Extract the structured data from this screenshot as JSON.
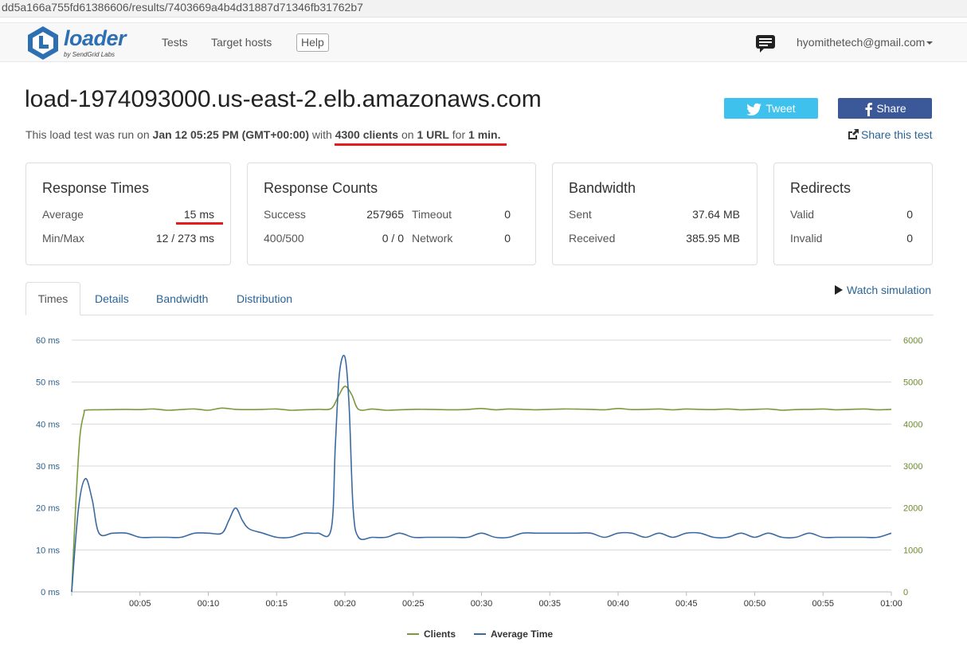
{
  "browser": {
    "url": "dd5a166a755fd61386606/results/7403669a4b4d31887d71346fb31762b7"
  },
  "navbar": {
    "logo_text": "loader",
    "logo_sub": "by SendGrid Labs",
    "links": [
      "Tests",
      "Target hosts"
    ],
    "help_label": "Help",
    "user": "hyomithetech@gmail.com",
    "icons": [
      "loader-logo-icon",
      "chat-icon",
      "chevron-down-icon"
    ]
  },
  "header": {
    "title": "load-1974093000.us-east-2.elb.amazonaws.com",
    "summary": {
      "prefix": "This load test was run on",
      "date": "Jan 12 05:25 PM (GMT+00:00)",
      "with": "with",
      "clients": "4300 clients",
      "on": "on",
      "urls": "1 URL",
      "for": "for",
      "duration": "1 min."
    },
    "tweet_label": "Tweet",
    "share_label": "Share",
    "share_test_label": "Share this test"
  },
  "panels": {
    "response_times": {
      "title": "Response Times",
      "average_label": "Average",
      "average_value": "15 ms",
      "minmax_label": "Min/Max",
      "minmax_value": "12 / 273 ms"
    },
    "response_counts": {
      "title": "Response Counts",
      "success_label": "Success",
      "success_value": "257965",
      "timeout_label": "Timeout",
      "timeout_value": "0",
      "err_label": "400/500",
      "err_value": "0 / 0",
      "network_label": "Network",
      "network_value": "0"
    },
    "bandwidth": {
      "title": "Bandwidth",
      "sent_label": "Sent",
      "sent_value": "37.64 MB",
      "received_label": "Received",
      "received_value": "385.95 MB"
    },
    "redirects": {
      "title": "Redirects",
      "valid_label": "Valid",
      "valid_value": "0",
      "invalid_label": "Invalid",
      "invalid_value": "0"
    }
  },
  "tabs": [
    "Times",
    "Details",
    "Bandwidth",
    "Distribution"
  ],
  "watch_simulation": "Watch simulation",
  "colors": {
    "clients": "#7a9b3a",
    "average_time": "#3a6aa0",
    "link": "#2a6496",
    "tweet": "#3ec1ec",
    "facebook": "#3b5998",
    "highlight": "#e31c1c"
  },
  "chart_data": {
    "type": "line",
    "x_ticks": [
      "00:05",
      "00:10",
      "00:15",
      "00:20",
      "00:25",
      "00:30",
      "00:35",
      "00:40",
      "00:45",
      "00:50",
      "00:55",
      "01:00"
    ],
    "y_left_ticks": [
      "60 ms",
      "50 ms",
      "40 ms",
      "30 ms",
      "20 ms",
      "10 ms",
      "0 ms"
    ],
    "y_right_ticks": [
      "6000",
      "5000",
      "4000",
      "3000",
      "2000",
      "1000",
      "0"
    ],
    "ylim_left": [
      0,
      60
    ],
    "ylim_right": [
      0,
      6000
    ],
    "xlim": [
      0,
      60
    ],
    "grid": true,
    "legend_position": "bottom-center",
    "series": [
      {
        "name": "Clients",
        "axis": "right",
        "color": "#7a9b3a",
        "x": [
          0,
          0.3,
          0.6,
          0.9,
          1,
          2,
          3,
          4,
          5,
          6,
          7,
          8,
          9,
          10,
          11,
          12,
          13,
          14,
          15,
          16,
          17,
          18,
          19,
          19.5,
          20,
          20.5,
          21,
          22,
          23,
          24,
          25,
          26,
          27,
          28,
          29,
          30,
          31,
          32,
          33,
          34,
          35,
          36,
          37,
          38,
          39,
          40,
          41,
          42,
          43,
          44,
          45,
          46,
          47,
          48,
          49,
          50,
          51,
          52,
          53,
          54,
          55,
          56,
          57,
          58,
          59,
          60
        ],
        "y": [
          0,
          2100,
          3700,
          4250,
          4330,
          4340,
          4345,
          4350,
          4345,
          4360,
          4330,
          4345,
          4360,
          4330,
          4380,
          4350,
          4345,
          4350,
          4360,
          4330,
          4340,
          4350,
          4370,
          4650,
          4900,
          4700,
          4350,
          4360,
          4330,
          4340,
          4350,
          4350,
          4345,
          4340,
          4350,
          4370,
          4340,
          4360,
          4350,
          4340,
          4350,
          4360,
          4355,
          4350,
          4340,
          4370,
          4345,
          4350,
          4360,
          4340,
          4360,
          4350,
          4345,
          4360,
          4340,
          4350,
          4360,
          4330,
          4345,
          4350,
          4360,
          4340,
          4350,
          4360,
          4340,
          4350
        ]
      },
      {
        "name": "Average Time",
        "axis": "left",
        "color": "#3a6aa0",
        "x": [
          0,
          0.5,
          1,
          1.5,
          2,
          3,
          4,
          5,
          6,
          7,
          8,
          9,
          10,
          11,
          11.5,
          12,
          12.5,
          13,
          14,
          15,
          16,
          17,
          18,
          19,
          19.3,
          19.6,
          20,
          20.3,
          20.6,
          21,
          22,
          23,
          24,
          25,
          26,
          27,
          28,
          29,
          30,
          31,
          32,
          33,
          34,
          35,
          36,
          37,
          38,
          39,
          40,
          41,
          42,
          43,
          44,
          45,
          46,
          47,
          48,
          49,
          50,
          51,
          52,
          53,
          54,
          55,
          56,
          57,
          58,
          59,
          60
        ],
        "y": [
          0,
          20,
          27,
          22,
          14,
          14,
          14,
          13,
          13,
          13,
          13,
          14,
          14,
          14,
          17,
          20,
          17,
          15,
          14,
          13,
          13,
          14,
          14,
          15,
          35,
          52,
          56,
          45,
          20,
          13,
          13,
          13,
          14,
          13,
          13,
          13,
          13,
          13,
          14,
          13,
          13,
          14,
          14,
          14,
          14,
          14,
          14,
          13,
          14,
          14,
          13,
          14,
          13,
          14,
          14,
          13,
          13,
          14,
          13,
          14,
          13,
          13,
          14,
          13,
          13,
          13,
          13,
          13,
          14
        ]
      }
    ]
  }
}
